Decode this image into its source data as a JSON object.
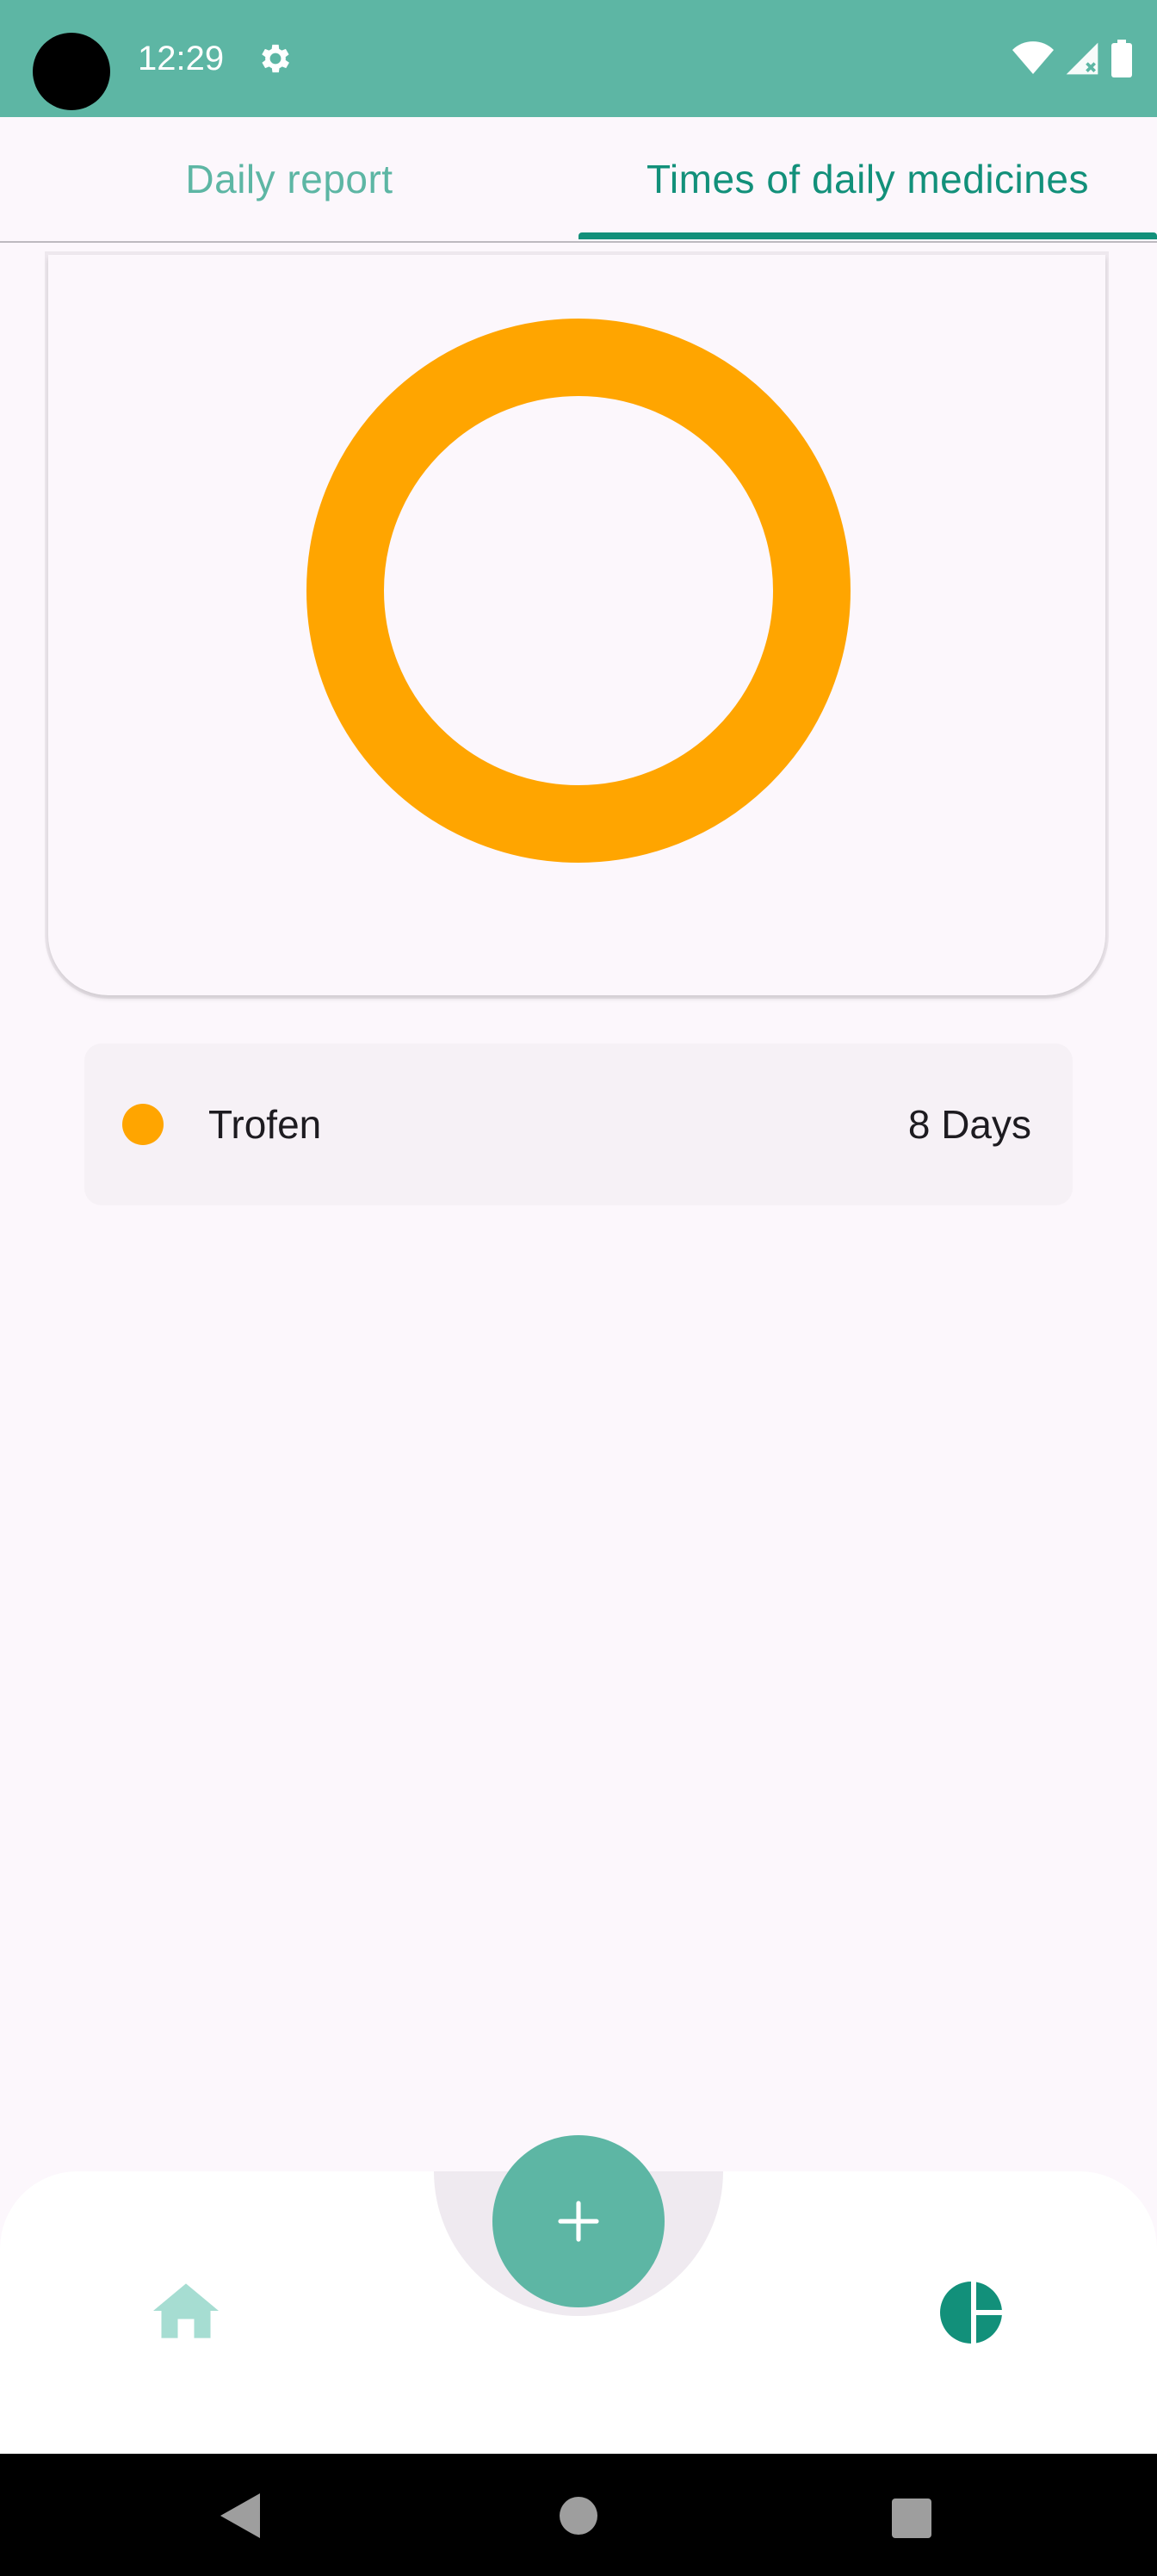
{
  "status_bar": {
    "time": "12:29",
    "icons": [
      "settings-icon",
      "wifi-icon",
      "signal-icon",
      "battery-icon"
    ]
  },
  "tabs": [
    {
      "label": "Daily report",
      "selected": false
    },
    {
      "label": "Times of daily medicines",
      "selected": true
    }
  ],
  "chart_data": {
    "type": "pie",
    "style": "donut",
    "slices": [
      {
        "label": "Trofen",
        "value": 8,
        "color": "#FFA500"
      }
    ]
  },
  "legend": [
    {
      "name": "Trofen",
      "value_text": "8 Days",
      "color": "#FFA500"
    }
  ],
  "bottom_nav": {
    "items": [
      "home-icon",
      "chart-icon"
    ],
    "fab_icon": "plus-icon"
  },
  "colors": {
    "primary": "#5DB6A4",
    "primary_dark": "#12907A",
    "background": "#FCF7FC",
    "slice": "#FFA500"
  }
}
